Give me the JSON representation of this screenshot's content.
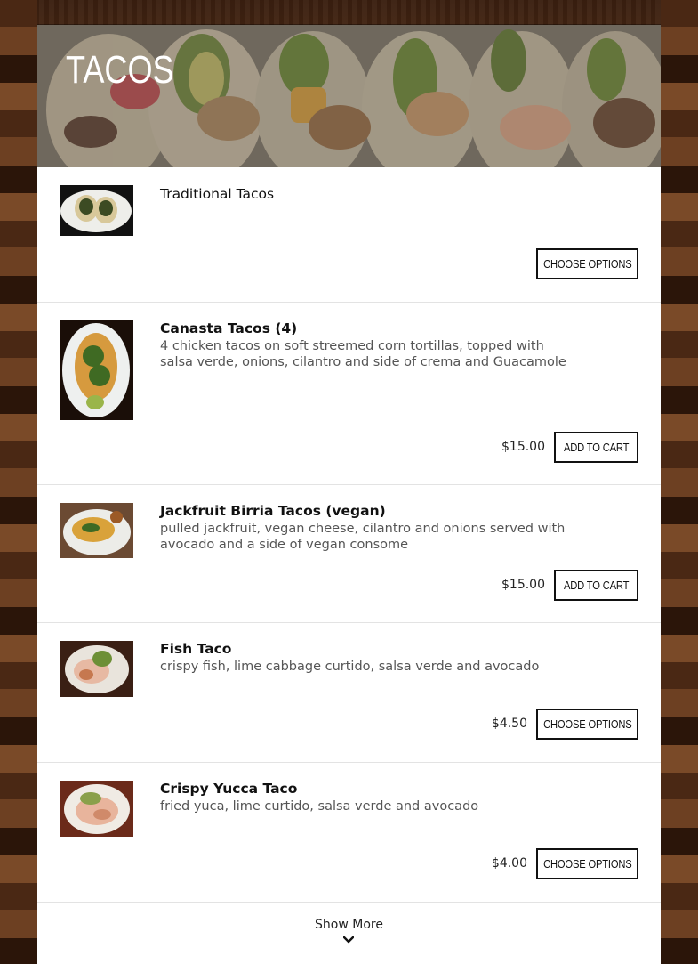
{
  "section_title": "TACOS",
  "items": [
    {
      "name": "Traditional Tacos",
      "description": "",
      "price": "",
      "button": "CHOOSE OPTIONS"
    },
    {
      "name": "Canasta Tacos (4)",
      "description": "4 chicken tacos on soft streemed corn tortillas, topped with salsa verde, onions, cilantro and side of crema and Guacamole",
      "price": "$15.00",
      "button": "ADD TO CART"
    },
    {
      "name": "Jackfruit Birria Tacos (vegan)",
      "description": "pulled jackfruit, vegan cheese, cilantro and onions served with avocado and a side of vegan consome",
      "price": "$15.00",
      "button": "ADD TO CART"
    },
    {
      "name": "Fish Taco",
      "description": "crispy fish, lime cabbage curtido, salsa verde and avocado",
      "price": "$4.50",
      "button": "CHOOSE OPTIONS"
    },
    {
      "name": "Crispy Yucca Taco",
      "description": "fried yuca, lime curtido, salsa verde and avocado",
      "price": "$4.00",
      "button": "CHOOSE OPTIONS"
    }
  ],
  "show_more": "Show More",
  "icons": {
    "show_more": "chevron-down-icon"
  },
  "colors": {
    "panel": "#ffffff",
    "button_border": "#111111",
    "text": "#111111",
    "description": "#555555"
  }
}
